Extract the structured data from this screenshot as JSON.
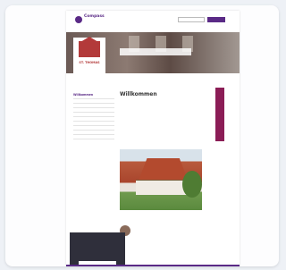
{
  "header": {
    "logo_line1": "",
    "logo_line2": "Compass",
    "search_placeholder": "",
    "search_button": ""
  },
  "hero": {
    "logo_name": "ST. THOMAS",
    "logo_sub": "",
    "banner_text": ""
  },
  "subnav": [],
  "sidebar": {
    "items": [
      {
        "label": "Willkommen",
        "active": true,
        "sub": false
      }
    ]
  },
  "main": {
    "title": "Willkommen",
    "paragraphs": [],
    "link_text": "",
    "contact_label": "",
    "contact_lines": []
  },
  "right_tab": "",
  "cookie": {
    "text": "",
    "button": ""
  },
  "colors": {
    "brand": "#5a2a86",
    "accent": "#8b1d56",
    "logo_red": "#b33a3a"
  }
}
